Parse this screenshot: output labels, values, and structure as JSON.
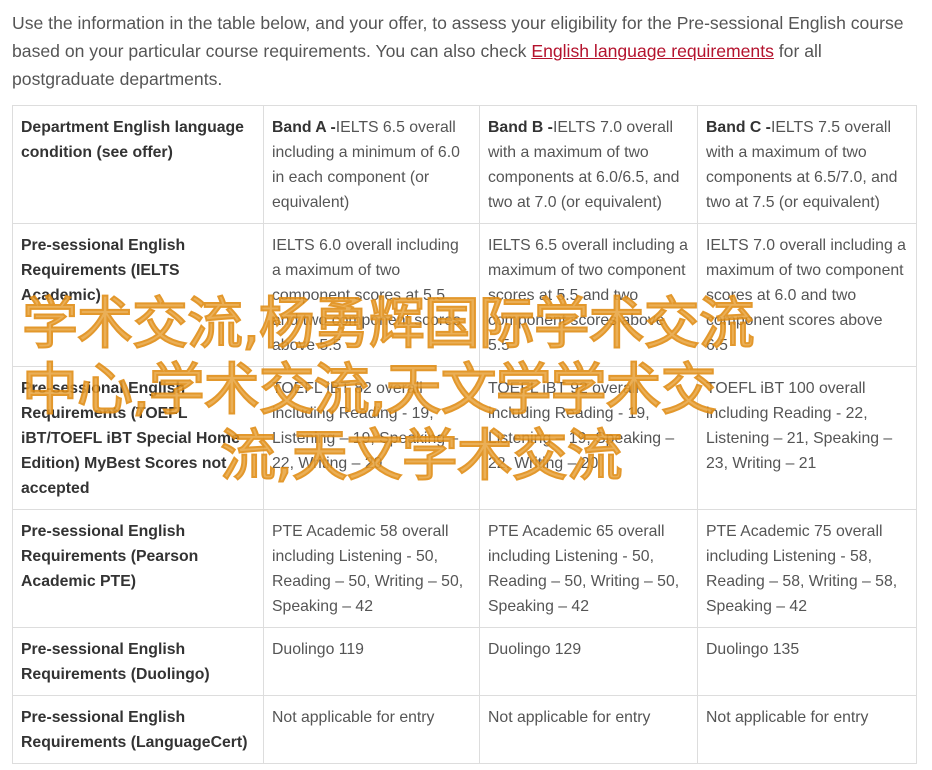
{
  "intro": {
    "text_before": "Use the information in the table below, and your offer, to assess your eligibility for the Pre-sessional English course based on your particular course requirements. You can also check ",
    "link_text": "English language requirements",
    "text_after": " for all postgraduate departments."
  },
  "table": {
    "header": {
      "col0": "Department English language condition (see offer)",
      "bands": [
        {
          "label": "Band A -",
          "text": "IELTS 6.5 overall including a minimum of 6.0 in each component (or equivalent)"
        },
        {
          "label": "Band B -",
          "text": "IELTS 7.0 overall with a maximum of two components at 6.0/6.5, and two at 7.0 (or equivalent)"
        },
        {
          "label": "Band C -",
          "text": "IELTS 7.5 overall with a maximum of two components at 6.5/7.0, and two at 7.5 (or equivalent)"
        }
      ]
    },
    "rows": [
      {
        "label": "Pre-sessional English Requirements (IELTS Academic)",
        "cells": [
          "IELTS 6.0 overall including a maximum of two component scores at 5.5 and two component scores above 5.5",
          "IELTS 6.5 overall including a maximum of two component scores at 5.5 and two component scores above 5.5",
          "IELTS 7.0 overall including a maximum of two component scores at 6.0 and two component scores above 6.5"
        ]
      },
      {
        "label": "Pre-sessional English Requirements (TOEFL iBT/TOEFL iBT Special Home Edition) MyBest Scores not accepted",
        "cells": [
          "TOEFL iBT 82 overall including Reading - 19, Listening – 19, Speaking – 22, Writing – 20",
          "TOEFL iBT 92 overall including Reading - 19, Listening – 19, Speaking – 22, Writing – 20",
          "TOEFL iBT 100 overall including Reading - 22, Listening – 21, Speaking – 23, Writing – 21"
        ]
      },
      {
        "label": "Pre-sessional English Requirements (Pearson Academic PTE)",
        "cells": [
          "PTE Academic 58 overall including Listening - 50, Reading – 50, Writing – 50, Speaking – 42",
          "PTE Academic 65 overall including Listening - 50, Reading – 50, Writing – 50, Speaking – 42",
          "PTE Academic 75 overall including Listening - 58, Reading – 58, Writing – 58, Speaking – 42"
        ]
      },
      {
        "label": "Pre-sessional English Requirements (Duolingo)",
        "cells": [
          "Duolingo 119",
          "Duolingo 129",
          "Duolingo 135"
        ]
      },
      {
        "label": "Pre-sessional English Requirements (LanguageCert)",
        "cells": [
          "Not applicable for entry",
          "Not applicable for entry",
          "Not applicable for entry"
        ]
      }
    ]
  },
  "watermark": {
    "line1": "学术交流,杨勇辉国际学术交流",
    "line2": "中心,学术交流,天文学学术交",
    "line3": "流,天文学术交流"
  }
}
